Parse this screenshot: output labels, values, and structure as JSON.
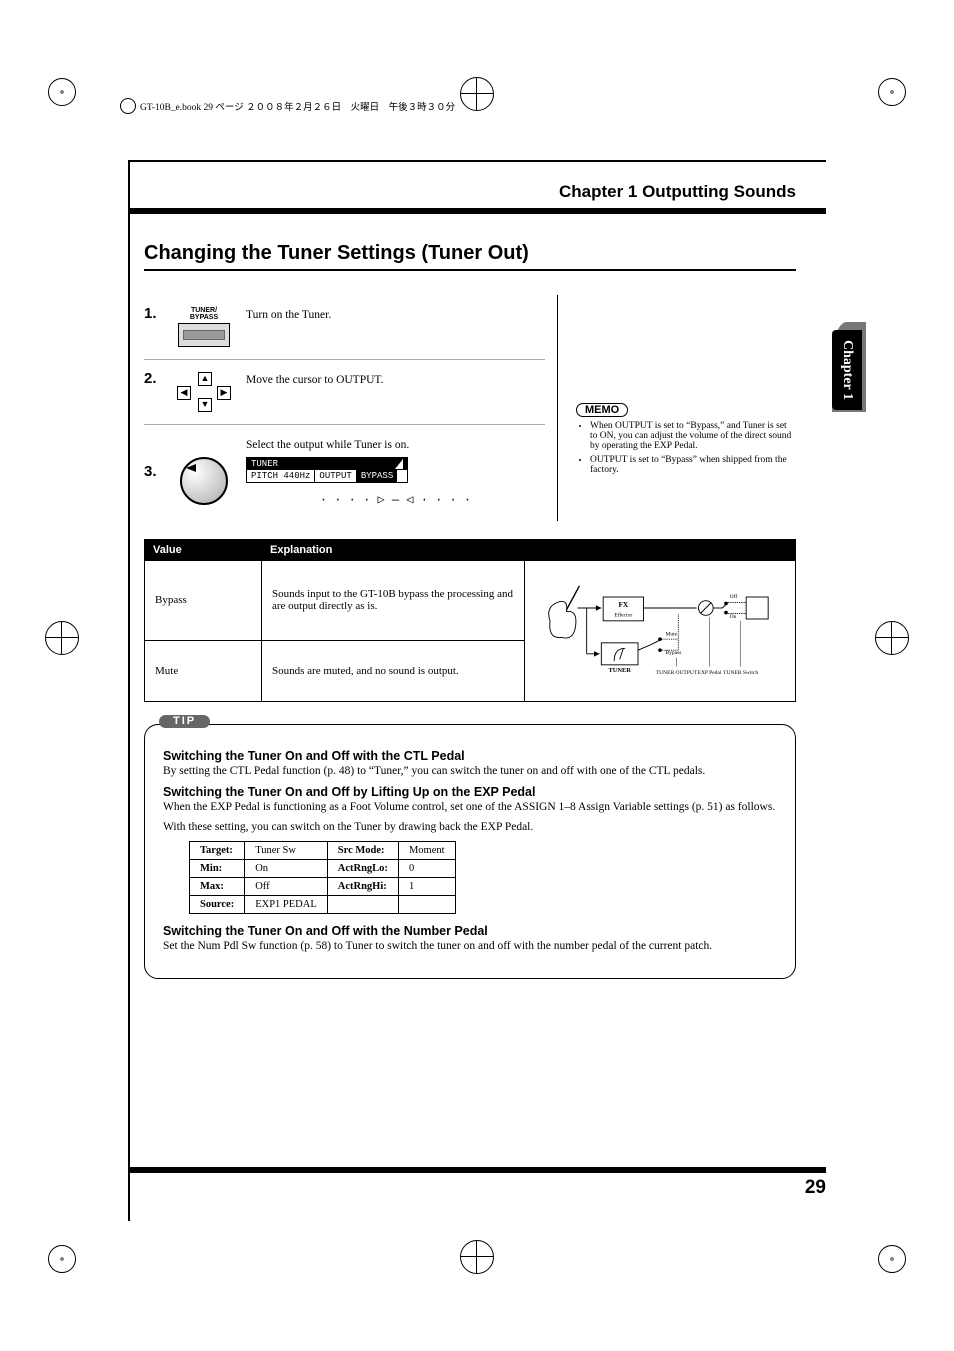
{
  "top_meta": "GT-10B_e.book  29 ページ  ２００８年２月２６日　火曜日　午後３時３０分",
  "page_title": "Chapter 1 Outputting Sounds",
  "side_tab": "Chapter 1",
  "section_title": "Changing the Tuner Settings (Tuner Out)",
  "steps": [
    {
      "num": "1.",
      "icon_label": "TUNER/\nBYPASS",
      "text": "Turn on the Tuner."
    },
    {
      "num": "2.",
      "icon_label": "",
      "text": "Move the cursor to OUTPUT."
    },
    {
      "num": "3.",
      "icon_label": "",
      "text": "Select the output while Tuner is on."
    }
  ],
  "lcd": {
    "title": "TUNER",
    "pitch": "PITCH 440Hz",
    "output_label": "OUTPUT",
    "output_value": "BYPASS",
    "bar": "· · · · ▷  —  ◁ · · · ·"
  },
  "memo": {
    "label": "MEMO",
    "items": [
      "When OUTPUT is set to “Bypass,” and Tuner is set to ON, you can adjust the volume of the direct sound by operating the EXP Pedal.",
      "OUTPUT is set to “Bypass” when shipped from the factory."
    ]
  },
  "value_table": {
    "headers": [
      "Value",
      "Explanation"
    ],
    "rows": [
      {
        "value": "Bypass",
        "explanation": "Sounds input to the GT-10B bypass the processing and are output directly as is."
      },
      {
        "value": "Mute",
        "explanation": "Sounds are muted, and no sound is output."
      }
    ],
    "diagram_labels": {
      "fx": "FX",
      "effector": "Effector",
      "off": "Off",
      "on": "On",
      "mute": "Mute",
      "bypass": "Bypass",
      "tuner": "TUNER",
      "tuner_output": "TUNER OUTPUT",
      "exp_pedal": "EXP Pedal",
      "tuner_switch": "TUNER Switch"
    }
  },
  "tip": {
    "label": "TIP",
    "sec1": {
      "title": "Switching the Tuner On and Off with the CTL Pedal",
      "body": "By setting the CTL Pedal function (p. 48) to “Tuner,” you can switch the tuner on and off with one of the CTL pedals."
    },
    "sec2": {
      "title": "Switching the Tuner On and Off by Lifting Up on the EXP Pedal",
      "body1": "When the EXP Pedal is functioning as a Foot Volume control, set one of the ASSIGN 1–8 Assign Variable settings (p. 51) as follows.",
      "body2": "With these setting, you can switch on the Tuner by drawing back the EXP Pedal.",
      "table": {
        "rows": [
          {
            "l": "Target:",
            "lv": "Tuner Sw",
            "r": "Src Mode:",
            "rv": "Moment"
          },
          {
            "l": "Min:",
            "lv": "On",
            "r": "ActRngLo:",
            "rv": "0"
          },
          {
            "l": "Max:",
            "lv": "Off",
            "r": "ActRngHi:",
            "rv": "1"
          },
          {
            "l": "Source:",
            "lv": "EXP1 PEDAL",
            "r": "",
            "rv": ""
          }
        ]
      }
    },
    "sec3": {
      "title": "Switching the Tuner On and Off with the Number Pedal",
      "body": "Set the Num Pdl Sw function (p. 58) to Tuner to switch the tuner on and off with the number pedal of the current patch."
    }
  },
  "page_number": "29"
}
